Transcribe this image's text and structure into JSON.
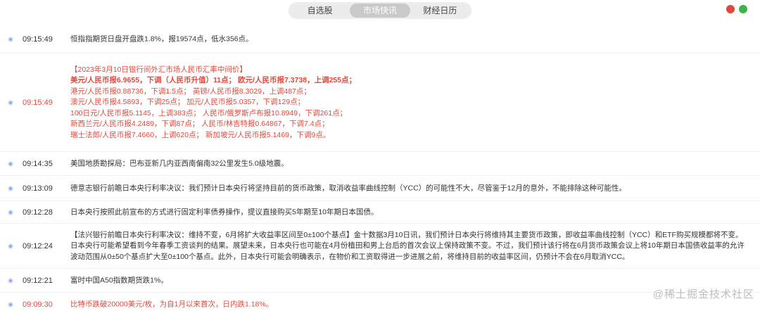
{
  "tabs": [
    {
      "label": "自选股"
    },
    {
      "label": "市场快讯"
    },
    {
      "label": "财经日历"
    }
  ],
  "window_controls": {
    "colors": [
      "#e0483c",
      "#3cb44b"
    ]
  },
  "news": [
    {
      "time": "09:15:49",
      "lines": [
        "恒指指期货日盘开盘跌1.8%，报19574点，低水356点。"
      ]
    },
    {
      "time": "09:15:49",
      "lines": [
        "【2023年3月10日银行间外汇市场人民币汇率中间价】",
        "美元/人民币报6.9655，下调（人民币升值）11点； 欧元/人民币报7.3738，上调255点；",
        "港元/人民币报0.88736，下调1.5点； 英镑/人民币报8.3029，上调487点；",
        "澳元/人民币报4.5893，下调25点； 加元/人民币报5.0357，下调129点；",
        "100日元/人民币报5.1145，上调383点； 人民币/俄罗斯卢布报10.8949，下调261点；",
        "新西兰元/人民币报4.2489，下调87点； 人民币/林吉特报0.64867，下调7.4点；",
        "瑞士法郎/人民币报7.4660，上调620点； 新加坡元/人民币报5.1469，下调9点。"
      ]
    },
    {
      "time": "09:14:35",
      "lines": [
        "美国地质勘探局：巴布亚新几内亚西南偏南32公里发生5.0级地震。"
      ]
    },
    {
      "time": "09:13:09",
      "lines": [
        "德意志银行前瞻日本央行利率决议：我们预计日本央行将坚持目前的货币政策，取消收益率曲线控制（YCC）的可能性不大，尽管鉴于12月的意外，不能排除这种可能性。"
      ]
    },
    {
      "time": "09:12:28",
      "lines": [
        "日本央行按照此前宣布的方式进行固定利率债券操作，提议直接购买5年期至10年期日本国债。"
      ]
    },
    {
      "time": "09:12:24",
      "lines": [
        "【法兴银行前瞻日本央行利率决议：维持不变，6月将扩大收益率区间至0±100个基点】金十数据3月10日讯，我们预计日本央行将维持其主要货币政策，即收益率曲线控制（YCC）和ETF购买规模都将不变。",
        "日本央行可能希望看到今年春季工资谈判的结果。展望未来，日本央行也可能在4月份植田和男上台后的首次会议上保持政策不变。不过，我们预计该行将在6月货币政策会议上将10年期日本国债收益率的允许",
        "波动范围从0±50个基点扩大至0±100个基点。此外，日本央行可能会明确表示，在物价和工资取得进一步进展之前，将维持目前的收益率区间，仍预计不会在6月取消YCC。"
      ]
    },
    {
      "time": "09:12:21",
      "lines": [
        "富时中国A50指数期货跌1%。"
      ]
    },
    {
      "time": "09:09:30",
      "lines": [
        "比特币跌破20000美元/枚，为自1月以来首次，日内跌1.18%。"
      ]
    }
  ],
  "watermark": "@稀土掘金技术社区"
}
